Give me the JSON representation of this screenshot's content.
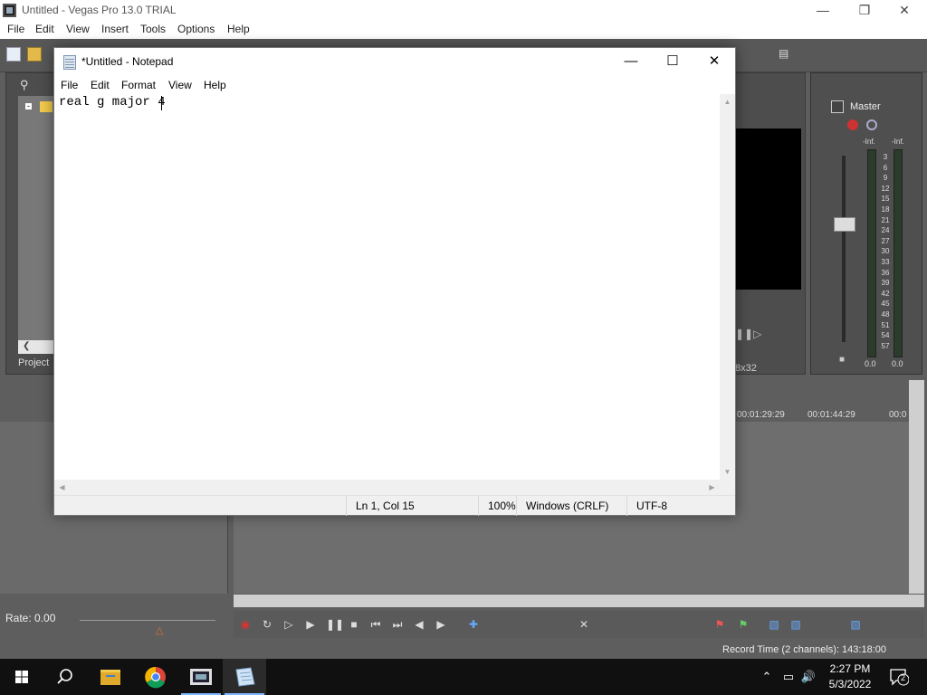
{
  "vegas": {
    "title": "Untitled - Vegas Pro 13.0 TRIAL",
    "menu": [
      "File",
      "Edit",
      "View",
      "Insert",
      "Tools",
      "Options",
      "Help"
    ],
    "project_tab": "Project",
    "preview_resolution": "8x32",
    "mixer_label": "Master",
    "meter_inf_left": "-Inf.",
    "meter_inf_right": "-Inf.",
    "meter_scale": [
      "3",
      "6",
      "9",
      "12",
      "15",
      "18",
      "21",
      "24",
      "27",
      "30",
      "33",
      "36",
      "39",
      "42",
      "45",
      "48",
      "51",
      "54",
      "57"
    ],
    "meter_zero_left": "0.0",
    "meter_zero_right": "0.0",
    "timecodes": [
      "00:01:29:29",
      "00:01:44:29",
      "00:0"
    ],
    "rate": "Rate: 0.00",
    "record_time": "Record Time (2 channels): 143:18:00"
  },
  "notepad": {
    "title": "*Untitled - Notepad",
    "menu": [
      "File",
      "Edit",
      "Format",
      "View",
      "Help"
    ],
    "content": "real g major 4",
    "status": {
      "position": "Ln 1, Col 15",
      "zoom": "100%",
      "line_ending": "Windows (CRLF)",
      "encoding": "UTF-8"
    }
  },
  "taskbar": {
    "time": "2:27 PM",
    "date": "5/3/2022",
    "notification_count": "2",
    "pinned_apps": [
      "start-icon",
      "search-icon",
      "file-explorer-icon",
      "chrome-icon",
      "vegas-icon",
      "notepad-icon"
    ]
  }
}
